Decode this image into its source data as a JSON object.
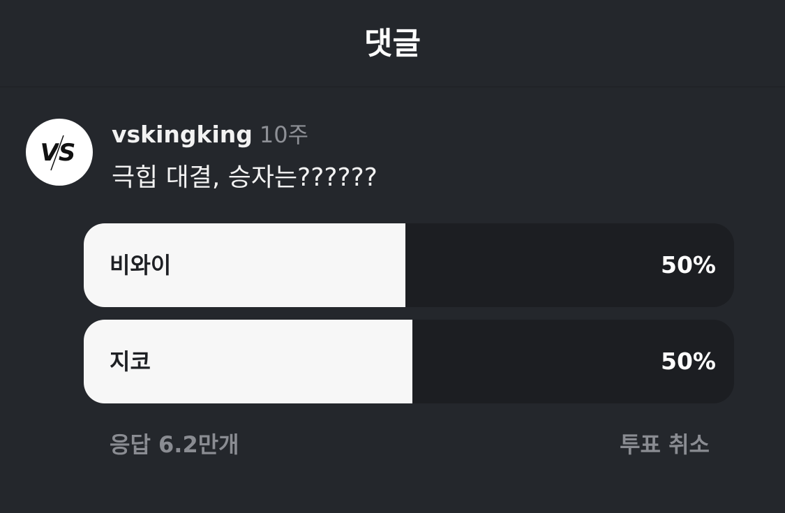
{
  "header": {
    "title": "댓글"
  },
  "comment": {
    "username": "vskingking",
    "time": "10주",
    "text": "극힙 대결, 승자는??????",
    "avatar_icon": "vs-logo-icon"
  },
  "poll": {
    "options": [
      {
        "label": "비와이",
        "percent_text": "50%",
        "fill_fraction": 0.495
      },
      {
        "label": "지코",
        "percent_text": "50%",
        "fill_fraction": 0.505
      }
    ],
    "response_count": "응답 6.2만개",
    "cancel_label": "투표 취소"
  },
  "colors": {
    "background": "#24272c",
    "option_track": "#1c1e22",
    "option_fill": "#f7f7f7",
    "muted_text": "#8a8c92"
  }
}
